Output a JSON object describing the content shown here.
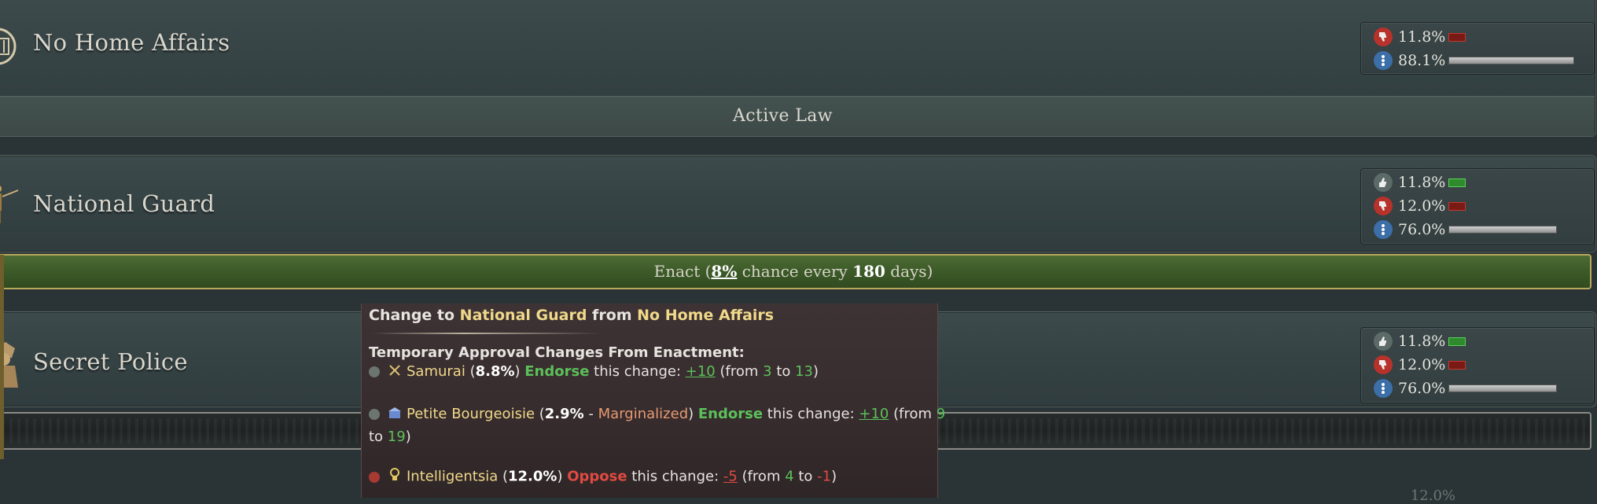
{
  "laws": [
    {
      "name": "No Home Affairs",
      "icon": "pillared-building-icon",
      "stats": [
        {
          "icon": "thumbs-down-icon",
          "value": "11.8%",
          "bar": "red"
        },
        {
          "icon": "neutral-icon",
          "value": "88.1%",
          "bar": "gray",
          "level": 0.881
        }
      ],
      "band_label": "Active Law"
    },
    {
      "name": "National Guard",
      "icon": "soldiers-icon",
      "stats": [
        {
          "icon": "thumbs-up-icon",
          "value": "11.8%",
          "bar": "green"
        },
        {
          "icon": "thumbs-down-icon",
          "value": "12.0%",
          "bar": "red"
        },
        {
          "icon": "neutral-icon",
          "value": "76.0%",
          "bar": "gray",
          "level": 0.76
        }
      ],
      "enact": {
        "prefix": "Enact (",
        "chance": "8%",
        "middle": " chance every ",
        "days": "180",
        "suffix": " days)"
      }
    },
    {
      "name": "Secret Police",
      "icon": "hooded-agent-icon",
      "stats": [
        {
          "icon": "thumbs-up-icon",
          "value": "11.8%",
          "bar": "green"
        },
        {
          "icon": "thumbs-down-icon",
          "value": "12.0%",
          "bar": "red"
        },
        {
          "icon": "neutral-icon",
          "value": "76.0%",
          "bar": "gray",
          "level": 0.76
        }
      ]
    }
  ],
  "peek_value": "12.0%",
  "tooltip": {
    "title_prefix": "Change to ",
    "title_to": "National Guard",
    "title_mid": " from ",
    "title_from": "No Home Affairs",
    "section": "Temporary Approval Changes From Enactment:",
    "groups": [
      {
        "name": "Samurai",
        "pct": "8.8%",
        "stance": "Endorse",
        "text": " this change: ",
        "delta": "+10",
        "from": "3",
        "to": "13",
        "icon": "crossed-swords-icon"
      },
      {
        "name": "Petite Bourgeoisie",
        "pct": "2.9%",
        "tag": "Marginalized",
        "stance": "Endorse",
        "text": " this change: ",
        "delta": "+10",
        "from": "9",
        "to": "19",
        "icon": "shop-icon"
      },
      {
        "name": "Intelligentsia",
        "pct": "12.0%",
        "stance": "Oppose",
        "text": " this change: ",
        "delta": "-5",
        "from": "4",
        "to": "-1",
        "icon": "lightbulb-icon"
      }
    ],
    "words": {
      "from": "(from ",
      "to_word": " to ",
      "close": ")"
    }
  },
  "colors": {
    "endorse": "#5cc05a",
    "oppose": "#e04a42",
    "highlight": "#f0d98a",
    "marginalized": "#e79a70"
  }
}
